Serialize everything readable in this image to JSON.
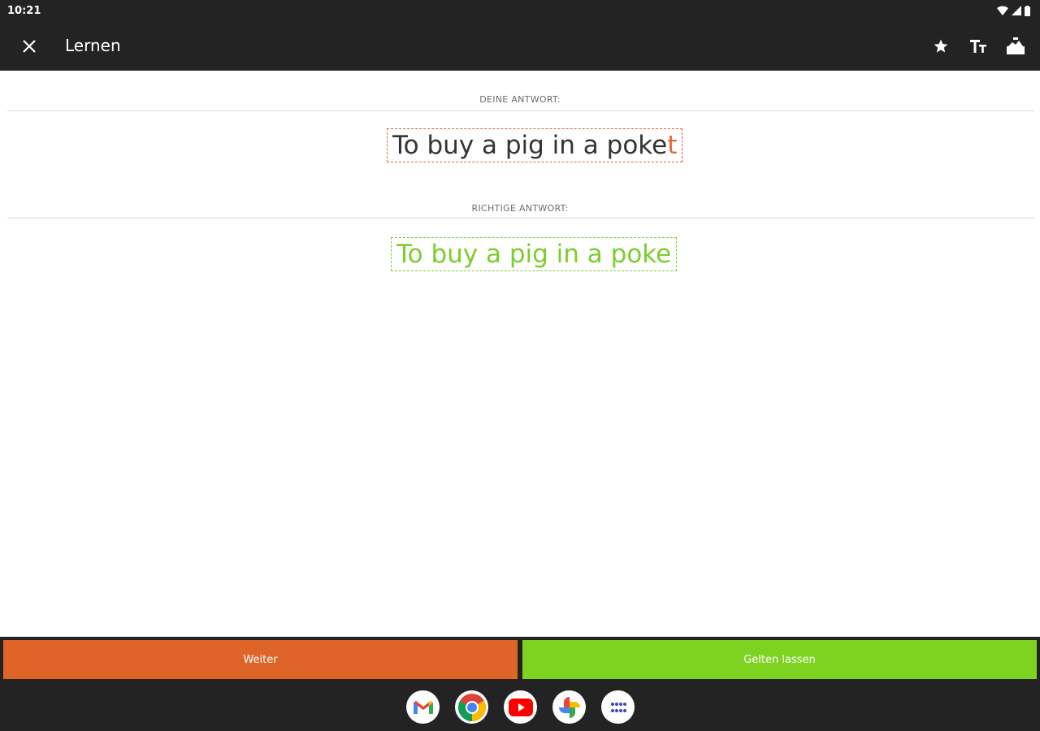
{
  "status_bar": {
    "time": "10:21"
  },
  "app_bar": {
    "title": "Lernen",
    "icons": [
      "close-icon",
      "star-icon",
      "text-size-icon",
      "landscape-icon"
    ]
  },
  "your_answer": {
    "label": "DEINE ANTWORT:",
    "text_correct_part": "To buy a pig in a poke",
    "text_wrong_part": "t"
  },
  "correct_answer": {
    "label": "RICHTIGE ANTWORT:",
    "text": "To buy a pig in a poke"
  },
  "buttons": {
    "next_label": "Weiter",
    "accept_label": "Gelten lassen"
  },
  "dock": [
    "gmail-icon",
    "chrome-icon",
    "youtube-icon",
    "photos-icon",
    "app-drawer-icon"
  ],
  "colors": {
    "wrong": "#e2683e",
    "correct": "#7ccd2e",
    "next_button": "#de6428",
    "accept_button": "#7ed321",
    "bar": "#232323"
  }
}
